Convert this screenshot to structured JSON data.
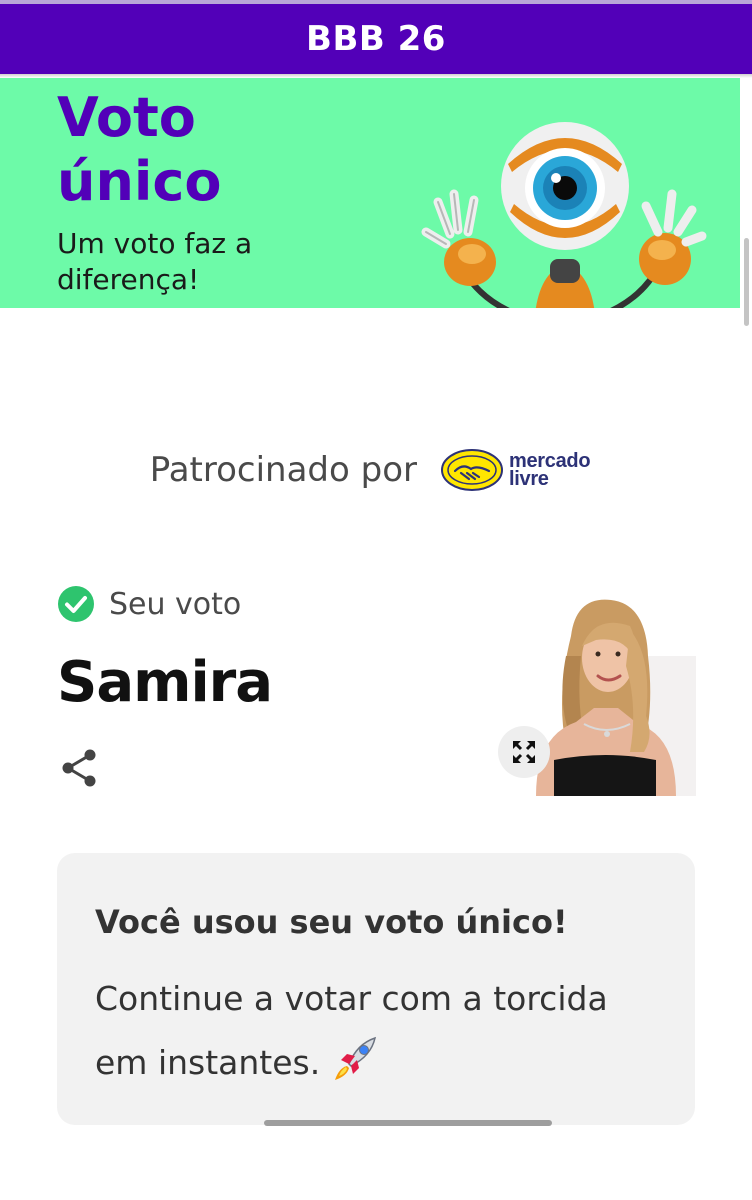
{
  "header": {
    "title": "BBB 26"
  },
  "banner": {
    "title": "Voto único",
    "subtitle": "Um voto faz a diferença!",
    "mascot_icon": "big-brother-eye-robot"
  },
  "sponsor": {
    "label": "Patrocinado por",
    "logo_line1": "mercado",
    "logo_line2": "livre"
  },
  "vote": {
    "status_label": "Seu voto",
    "status_icon": "check-circle-icon",
    "candidate_name": "Samira",
    "share_icon": "share-icon",
    "expand_icon": "expand-icon"
  },
  "info": {
    "title": "Você usou seu voto único!",
    "body": "Continue a votar com a torcida em instantes.",
    "rocket_icon": "rocket-icon"
  },
  "colors": {
    "header_bg": "#5200b8",
    "banner_bg": "#6dfaa8",
    "accent_purple": "#5200b8",
    "check_green": "#2ec46e",
    "card_bg": "#f2f2f2"
  }
}
